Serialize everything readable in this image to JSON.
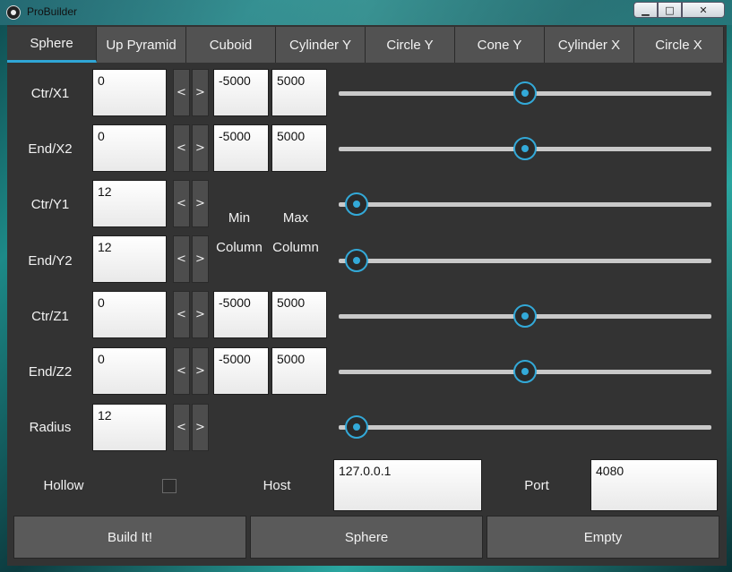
{
  "window": {
    "title": "ProBuilder",
    "minimize_glyph": "▁",
    "maximize_glyph": "□",
    "close_glyph": "✕"
  },
  "tabs": [
    "Sphere",
    "Up Pyramid",
    "Cuboid",
    "Cylinder Y",
    "Circle Y",
    "Cone Y",
    "Cylinder X",
    "Circle X"
  ],
  "active_tab": "Sphere",
  "params": [
    {
      "label": "Ctr/X1",
      "value": "0",
      "min": "-5000",
      "max": "5000",
      "slider": 0.5
    },
    {
      "label": "End/X2",
      "value": "0",
      "min": "-5000",
      "max": "5000",
      "slider": 0.5
    },
    {
      "label": "Ctr/Y1",
      "value": "12",
      "slider": 0.047
    },
    {
      "label": "End/Y2",
      "value": "12",
      "slider": 0.047
    },
    {
      "label": "Ctr/Z1",
      "value": "0",
      "min": "-5000",
      "max": "5000",
      "slider": 0.5
    },
    {
      "label": "End/Z2",
      "value": "0",
      "min": "-5000",
      "max": "5000",
      "slider": 0.5
    },
    {
      "label": "Radius",
      "value": "12",
      "slider": 0.047
    }
  ],
  "arrows": {
    "left": "<",
    "right": ">"
  },
  "captions": {
    "min_line1": "Min",
    "min_line2": "Column",
    "max_line1": "Max",
    "max_line2": "Column"
  },
  "options": {
    "hollow_label": "Hollow",
    "hollow_checked": false,
    "host_label": "Host",
    "host_value": "127.0.0.1",
    "port_label": "Port",
    "port_value": "4080"
  },
  "actions": [
    "Build It!",
    "Sphere",
    "Empty"
  ],
  "colors": {
    "accent": "#33a9d8",
    "panel": "#333333",
    "tab": "#525252"
  }
}
